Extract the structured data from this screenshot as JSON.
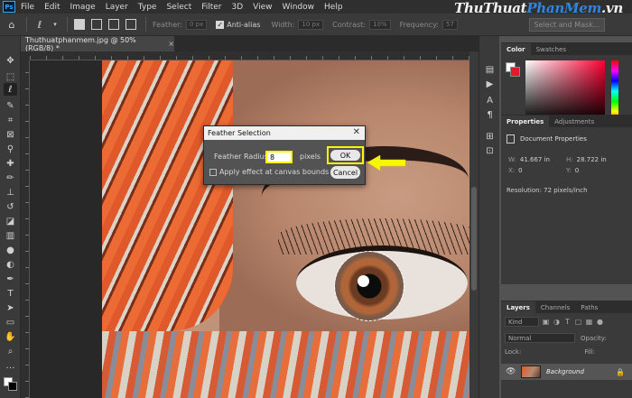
{
  "menu": {
    "app_logo": "Ps",
    "items": [
      "File",
      "Edit",
      "Image",
      "Layer",
      "Type",
      "Select",
      "Filter",
      "3D",
      "View",
      "Window",
      "Help"
    ],
    "watermark_a": "ThuThuat",
    "watermark_b": "PhanMem",
    "watermark_c": ".vn"
  },
  "options": {
    "feather_label": "Feather:",
    "feather_value": "0 px",
    "antialias_label": "Anti-alias",
    "width_label": "Width:",
    "width_value": "10 px",
    "contrast_label": "Contrast:",
    "contrast_value": "10%",
    "frequency_label": "Frequency:",
    "frequency_value": "57",
    "select_mask": "Select and Mask..."
  },
  "document": {
    "tab_title": "Thuthuatphanmem.jpg @ 50% (RGB/8) *",
    "close_glyph": "×"
  },
  "panels": {
    "color_tab": "Color",
    "swatches_tab": "Swatches",
    "properties_tab": "Properties",
    "adjustments_tab": "Adjustments",
    "doc_properties": "Document Properties",
    "w_label": "W:",
    "w_value": "41.667 in",
    "h_label": "H:",
    "h_value": "28.722 in",
    "x_label": "X:",
    "x_value": "0",
    "y_label": "Y:",
    "y_value": "0",
    "resolution": "Resolution: 72 pixels/inch",
    "layers_tab": "Layers",
    "channels_tab": "Channels",
    "paths_tab": "Paths",
    "kind": "Kind",
    "blend_mode": "Normal",
    "opacity_label": "Opacity:",
    "lock_label": "Lock:",
    "fill_label": "Fill:",
    "layer_name": "Background"
  },
  "dialog": {
    "title": "Feather Selection",
    "radius_label": "Feather Radius:",
    "radius_value": "8",
    "unit": "pixels",
    "ok": "OK",
    "cancel": "Cancel",
    "apply_label": "Apply effect at canvas bounds"
  },
  "colors": {
    "highlight": "#f7f700",
    "accent_blue": "#31a8ff",
    "background_color": "#e01b2c"
  }
}
